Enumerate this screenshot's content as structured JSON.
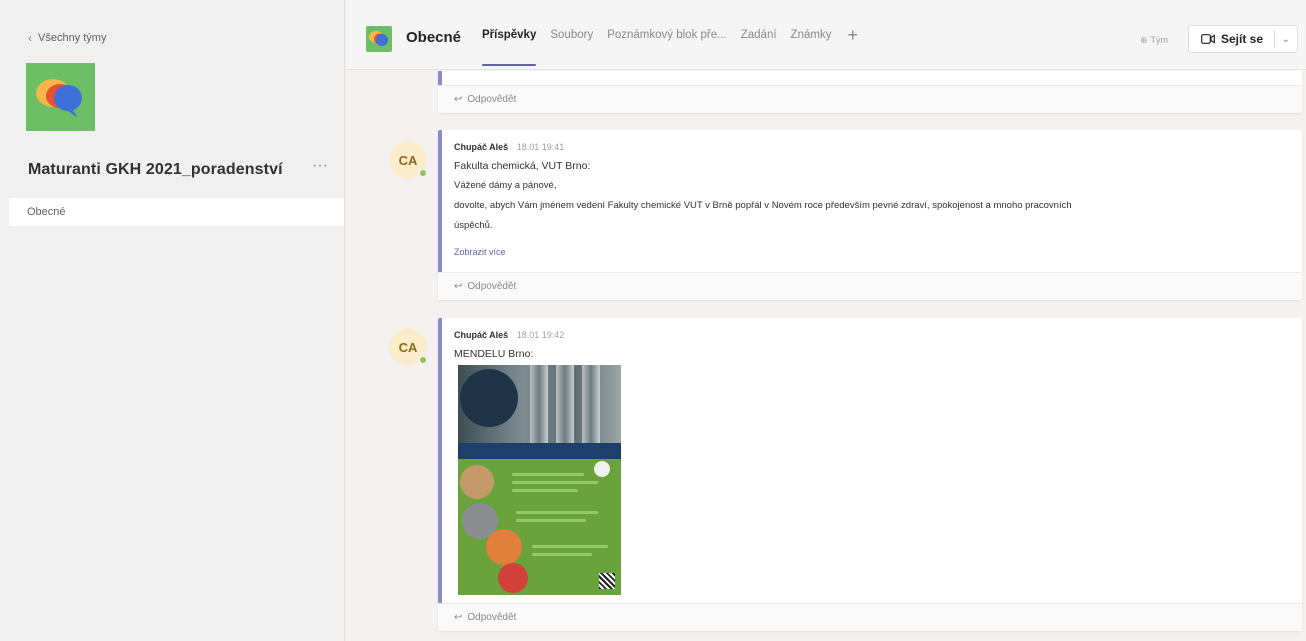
{
  "sidebar": {
    "back_label": "Všechny týmy",
    "team_name": "Maturanti GKH 2021_poradenství",
    "more_label": "···",
    "channels": [
      {
        "label": "Obecné"
      }
    ]
  },
  "header": {
    "channel_title": "Obecné",
    "tabs": [
      {
        "label": "Příspěvky"
      },
      {
        "label": "Soubory"
      },
      {
        "label": "Poznámkový blok pře..."
      },
      {
        "label": "Zadání"
      },
      {
        "label": "Známky"
      }
    ],
    "add_tab": "+",
    "team_button": "Tým",
    "meet_button": "Sejít se",
    "meet_dropdown": "⌄"
  },
  "posts": [
    {
      "reply_label": "Odpovědět"
    },
    {
      "avatar": "CA",
      "author": "Chupáč Aleš",
      "time": "18.01 19:41",
      "lines": [
        "Fakulta chemická, VUT Brno:",
        "Vážené dámy a pánové,",
        "dovolte, abych Vám jménem vedení Fakulty chemické VUT v Brně popřál v Novém roce především pevné zdraví, spokojenost a mnoho pracovních",
        "úspěchů."
      ],
      "show_more": "Zobrazit více",
      "reply_label": "Odpovědět"
    },
    {
      "avatar": "CA",
      "author": "Chupáč Aleš",
      "time": "18.01 19:42",
      "lines": [
        "MENDELU Brno:"
      ],
      "reply_label": "Odpovědět"
    }
  ]
}
